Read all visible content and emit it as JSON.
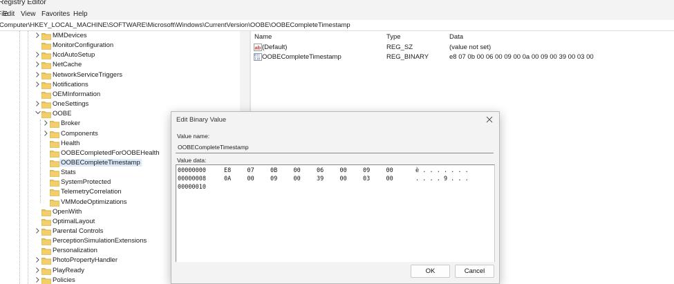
{
  "window": {
    "title": "Registry Editor"
  },
  "menu": [
    "File",
    "Edit",
    "View",
    "Favorites",
    "Help"
  ],
  "address": "Computer\\HKEY_LOCAL_MACHINE\\SOFTWARE\\Microsoft\\Windows\\CurrentVersion\\OOBE\\OOBECompleteTimestamp",
  "tree": [
    {
      "label": "MMDevices",
      "level": 1,
      "expander": "collapsed"
    },
    {
      "label": "MonitorConfiguration",
      "level": 1,
      "expander": "none"
    },
    {
      "label": "NcdAutoSetup",
      "level": 1,
      "expander": "collapsed"
    },
    {
      "label": "NetCache",
      "level": 1,
      "expander": "collapsed"
    },
    {
      "label": "NetworkServiceTriggers",
      "level": 1,
      "expander": "collapsed"
    },
    {
      "label": "Notifications",
      "level": 1,
      "expander": "collapsed"
    },
    {
      "label": "OEMInformation",
      "level": 1,
      "expander": "none"
    },
    {
      "label": "OneSettings",
      "level": 1,
      "expander": "collapsed"
    },
    {
      "label": "OOBE",
      "level": 1,
      "expander": "expanded"
    },
    {
      "label": "Broker",
      "level": 2,
      "expander": "collapsed"
    },
    {
      "label": "Components",
      "level": 2,
      "expander": "collapsed"
    },
    {
      "label": "Health",
      "level": 2,
      "expander": "none"
    },
    {
      "label": "OOBECompletedForOOBEHealth",
      "level": 2,
      "expander": "none"
    },
    {
      "label": "OOBECompleteTimestamp",
      "level": 2,
      "expander": "none",
      "selected": true
    },
    {
      "label": "Stats",
      "level": 2,
      "expander": "none"
    },
    {
      "label": "SystemProtected",
      "level": 2,
      "expander": "none"
    },
    {
      "label": "TelemetryCorrelation",
      "level": 2,
      "expander": "none"
    },
    {
      "label": "VMModeOptimizations",
      "level": 2,
      "expander": "none"
    },
    {
      "label": "OpenWith",
      "level": 1,
      "expander": "none"
    },
    {
      "label": "OptimalLayout",
      "level": 1,
      "expander": "none"
    },
    {
      "label": "Parental Controls",
      "level": 1,
      "expander": "collapsed"
    },
    {
      "label": "PerceptionSimulationExtensions",
      "level": 1,
      "expander": "none"
    },
    {
      "label": "Personalization",
      "level": 1,
      "expander": "none"
    },
    {
      "label": "PhotoPropertyHandler",
      "level": 1,
      "expander": "collapsed"
    },
    {
      "label": "PlayReady",
      "level": 1,
      "expander": "collapsed"
    },
    {
      "label": "Policies",
      "level": 1,
      "expander": "collapsed"
    }
  ],
  "list": {
    "headers": {
      "name": "Name",
      "type": "Type",
      "data": "Data"
    },
    "rows": [
      {
        "icon": "string-value-icon",
        "name": "(Default)",
        "type": "REG_SZ",
        "data": "(value not set)"
      },
      {
        "icon": "binary-value-icon",
        "name": "OOBECompleteTimestamp",
        "type": "REG_BINARY",
        "data": "e8 07 0b 00 06 00 09 00 0a 00 09 00 39 00 03 00"
      }
    ]
  },
  "dialog": {
    "title": "Edit Binary Value",
    "value_name_label": "Value name:",
    "value_name": "OOBECompleteTimestamp",
    "value_data_label": "Value data:",
    "hex_rows": [
      {
        "offset": "00000000",
        "bytes": [
          "E8",
          "07",
          "0B",
          "00",
          "06",
          "00",
          "09",
          "00"
        ],
        "ascii": "è . . . . . . ."
      },
      {
        "offset": "00000008",
        "bytes": [
          "0A",
          "00",
          "09",
          "00",
          "39",
          "00",
          "03",
          "00"
        ],
        "ascii": ". . . . 9 . . ."
      },
      {
        "offset": "00000010",
        "bytes": [],
        "ascii": ""
      }
    ],
    "ok_label": "OK",
    "cancel_label": "Cancel"
  },
  "colors": {
    "folder": "#e8c25a",
    "selection": "#dbe9f8",
    "chrome": "#f3f3f3"
  }
}
